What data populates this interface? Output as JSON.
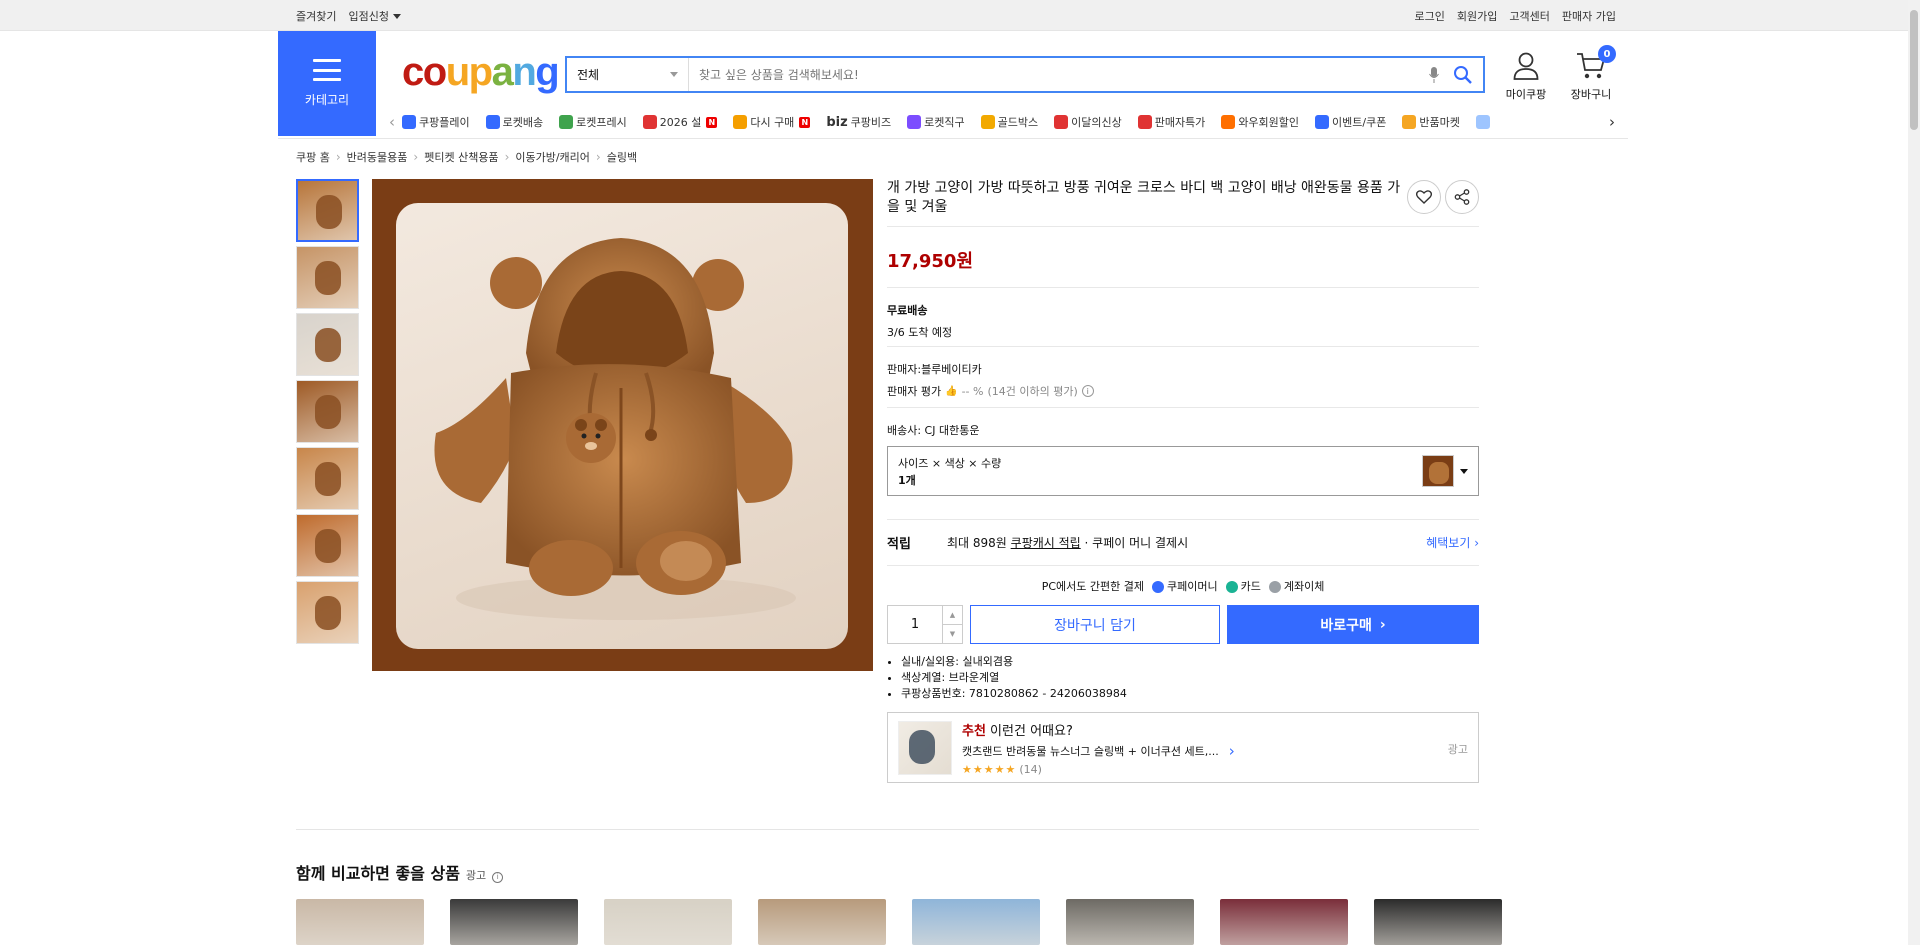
{
  "topbar": {
    "left": [
      "즐겨찾기",
      "입점신청"
    ],
    "right": [
      "로그인",
      "회원가입",
      "고객센터",
      "판매자 가입"
    ]
  },
  "header": {
    "category_label": "카테고리",
    "logo": "coupang",
    "logo_colors": [
      "#c01b13",
      "#c01b13",
      "#f5a623",
      "#f5a623",
      "#7bb241",
      "#52a9e0",
      "#346aff"
    ],
    "search_scope": "전체",
    "search_placeholder": "찾고 싶은 상품을 검색해보세요!",
    "mycoupang_label": "마이쿠팡",
    "cart_label": "장바구니",
    "cart_count": "0"
  },
  "service_nav": [
    {
      "label": "쿠팡플레이",
      "icon": "play-icon",
      "color": "#346aff"
    },
    {
      "label": "로켓배송",
      "icon": "rocket-icon",
      "color": "#346aff"
    },
    {
      "label": "로켓프레시",
      "icon": "rocket-fresh-icon",
      "color": "#3fa34d"
    },
    {
      "label": "2026 설",
      "icon": "gift-icon",
      "color": "#e03333",
      "new": "N"
    },
    {
      "label": "다시 구매",
      "icon": "house-icon",
      "color": "#f59f00",
      "new": "N"
    },
    {
      "label": "쿠팡비즈",
      "icon": "biz-icon",
      "color": "#333333",
      "prefix": "biz"
    },
    {
      "label": "로켓직구",
      "icon": "globe-icon",
      "color": "#7c4dff"
    },
    {
      "label": "골드박스",
      "icon": "goldbox-icon",
      "color": "#f2a900"
    },
    {
      "label": "이달의신상",
      "icon": "new-icon",
      "color": "#e03333"
    },
    {
      "label": "판매자특가",
      "icon": "percent-icon",
      "color": "#e03333"
    },
    {
      "label": "와우회원할인",
      "icon": "wow-icon",
      "color": "#ff6f00"
    },
    {
      "label": "이벤트/쿠폰",
      "icon": "coupon-icon",
      "color": "#346aff"
    },
    {
      "label": "반품마켓",
      "icon": "market-icon",
      "color": "#f5a623"
    },
    {
      "label": "",
      "icon": "more-icon",
      "color": "#9ec5ff"
    }
  ],
  "breadcrumb": [
    "쿠팡 홈",
    "반려동물용품",
    "펫티켓 산책용품",
    "이동가방/캐리어",
    "슬링백"
  ],
  "gallery": {
    "thumbs": [
      {
        "icon": "teddy-hoodie-thumb",
        "bg": "#b7753a"
      },
      {
        "icon": "dog-in-bag-thumb",
        "bg": "#c69466"
      },
      {
        "icon": "detail-collage-thumb",
        "bg": "#d8d3cc"
      },
      {
        "icon": "bag-front-thumb",
        "bg": "#9e5a25"
      },
      {
        "icon": "dog-wearing-thumb",
        "bg": "#c8864a"
      },
      {
        "icon": "hanging-bag-thumb",
        "bg": "#bf6b2d"
      },
      {
        "icon": "shoulder-carry-thumb",
        "bg": "#d9a16e"
      }
    ]
  },
  "product": {
    "title": "개 가방 고양이 가방 따뜻하고 방풍 귀여운 크로스 바디 백 고양이 배낭 애완동물 용품 가을 및 겨울",
    "price": "17,950원",
    "shipping_title": "무료배송",
    "arrival": "3/6 도착 예정",
    "seller": "판매자:블루베이티카",
    "seller_rating_label": "판매자 평가",
    "seller_rating_value": "-- %",
    "seller_rating_note": "(14건 이하의 평가)",
    "carrier": "배송사:  CJ 대한통운",
    "option_label": "사이즈 × 색상 × 수량",
    "option_value": "1개",
    "reward_label": "적립",
    "reward_text_pre": "최대 898원 ",
    "reward_text_link": "쿠팡캐시 적립",
    "reward_text_post": " · 쿠페이 머니 결제시",
    "reward_more": "혜택보기 ›",
    "pay_title": "PC에서도 간편한 결제",
    "pay_methods": [
      {
        "label": "쿠페이머니",
        "color": "#346aff"
      },
      {
        "label": "카드",
        "color": "#1ab394"
      },
      {
        "label": "계좌이체",
        "color": "#9aa0a6"
      }
    ],
    "quantity": "1",
    "add_to_cart": "장바구니 담기",
    "buy_now": "바로구매",
    "attributes": [
      "실내/실외용: 실내외겸용",
      "색상계열: 브라운계열",
      "쿠팡상품번호: 7810280862 - 24206038984"
    ]
  },
  "recommend": {
    "badge": "추천",
    "title": " 이런건 어때요?",
    "name": "캣츠랜드 반려동물 뉴스너그 슬링백 + 이너쿠션 세트,...",
    "stars": "★★★★★",
    "count": "(14)",
    "ad": "광고"
  },
  "compare": {
    "heading": "함께 비교하면 좋을 상품",
    "ad": "광고",
    "items": [
      {
        "icon": "compare-product-1",
        "color": "#c9b8a6"
      },
      {
        "icon": "compare-product-2",
        "color": "#3a3a3a"
      },
      {
        "icon": "compare-product-3",
        "color": "#d7d1c5"
      },
      {
        "icon": "compare-product-4",
        "color": "#b79a7c"
      },
      {
        "icon": "compare-product-5",
        "color": "#8fb5d9"
      },
      {
        "icon": "compare-product-6",
        "color": "#6d6a64"
      },
      {
        "icon": "compare-product-7",
        "color": "#7a2e3a"
      },
      {
        "icon": "compare-product-8",
        "color": "#2b2b2b"
      }
    ]
  }
}
